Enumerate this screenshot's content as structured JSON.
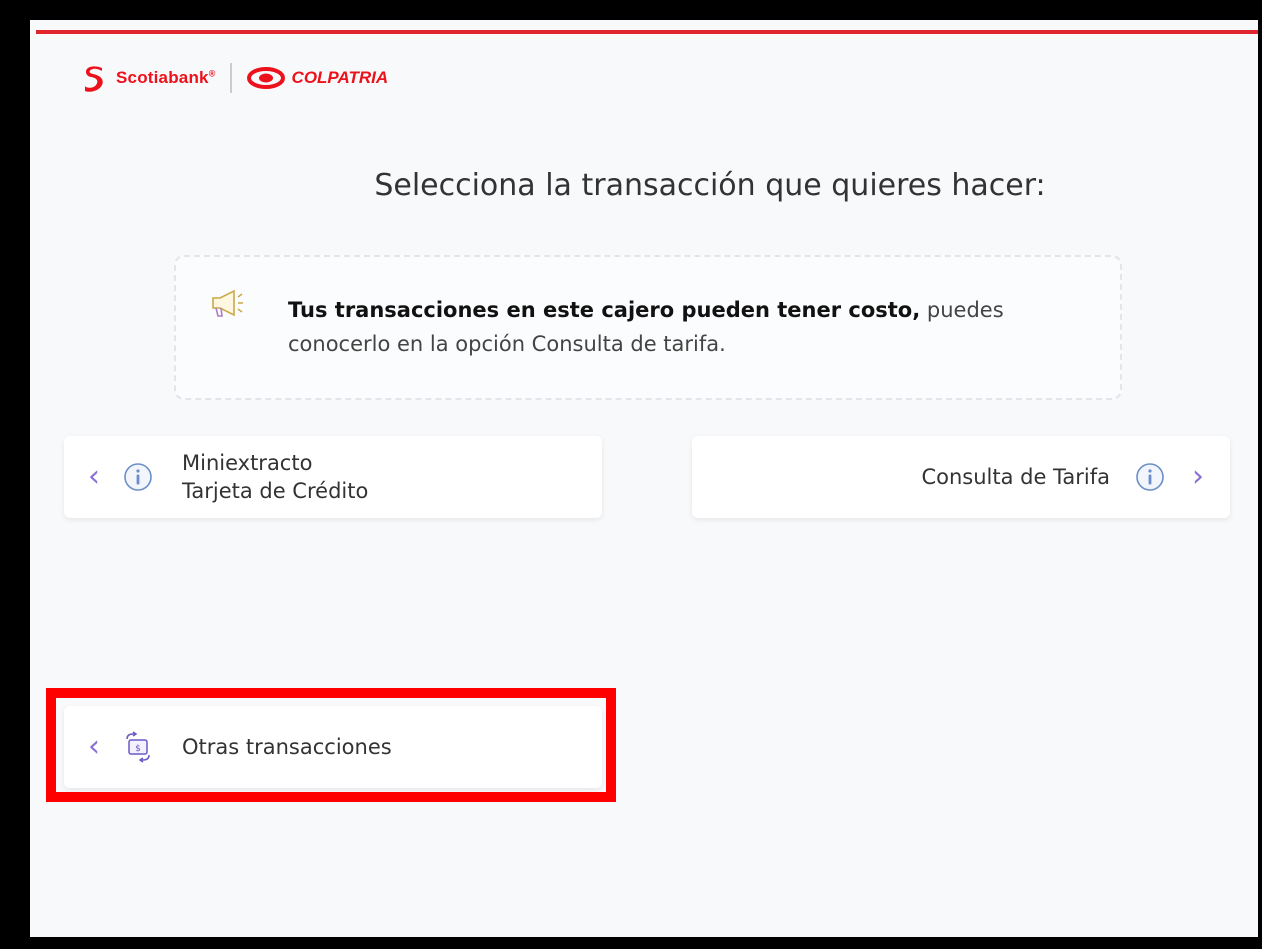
{
  "header": {
    "brand_primary": "Scotiabank",
    "brand_primary_mark": "®",
    "brand_secondary": "COLPATRIA",
    "brand_color": "#ec111a"
  },
  "main": {
    "title": "Selecciona la transacción que quieres hacer:",
    "notice": {
      "icon": "megaphone-icon",
      "bold_text": "Tus transacciones en este cajero pueden tener costo,",
      "text": " puedes conocerlo en la opción Consulta de tarifa."
    },
    "options": [
      {
        "label_line1": "Miniextracto",
        "label_line2": "Tarjeta de Crédito",
        "icon": "info-icon",
        "side": "left"
      },
      {
        "label": "Consulta de Tarifa",
        "icon": "info-icon",
        "side": "right"
      },
      {
        "label": "Otras transacciones",
        "icon": "money-exchange-icon",
        "side": "left"
      }
    ]
  },
  "colors": {
    "accent": "#8a6fd6",
    "highlight": "#ff0000",
    "rule": "#e1252f"
  }
}
